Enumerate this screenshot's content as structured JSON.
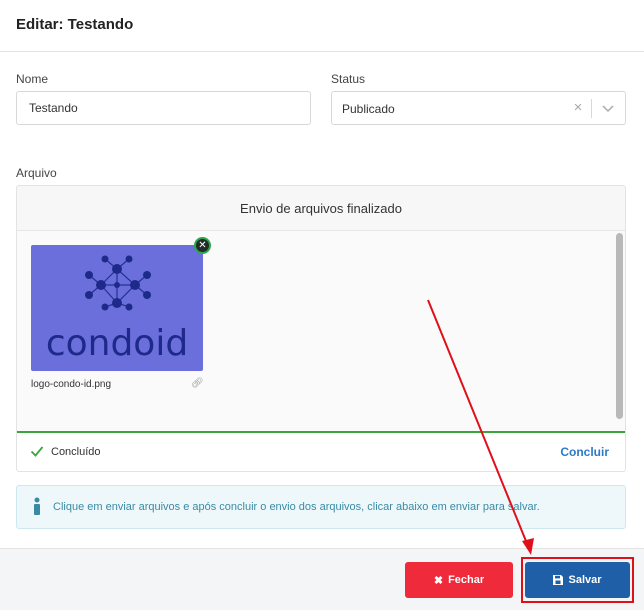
{
  "header": {
    "title": "Editar: Testando"
  },
  "form": {
    "name_label": "Nome",
    "name_value": "Testando",
    "status_label": "Status",
    "status_value": "Publicado",
    "file_label": "Arquivo"
  },
  "upload": {
    "header_text": "Envio de arquivos finalizado",
    "file_name": "logo-condo-id.png",
    "thumbnail_text": "condoid",
    "status_text": "Concluído",
    "conclude_label": "Concluir",
    "progress_percent": 100
  },
  "info": {
    "message": "Clique em enviar arquivos e após concluir o envio dos arquivos, clicar abaixo em enviar para salvar."
  },
  "footer": {
    "close_label": "Fechar",
    "save_label": "Salvar"
  },
  "icons": {
    "status_clear": "close-icon",
    "status_caret": "chevron-down-icon",
    "remove_file": "close-icon",
    "file_link": "link-icon",
    "status_check": "check-icon",
    "info": "info-icon",
    "close_button": "close-icon",
    "save_button": "floppy-disk-icon"
  },
  "colors": {
    "close_button": "#ee2a3b",
    "save_button": "#1e5fa8",
    "conclude_link": "#2b7bc9",
    "success": "#3aa53e",
    "info_text": "#3a8aa6",
    "annotation": "#e0101a",
    "thumbnail_bg": "#6b6fdc"
  }
}
